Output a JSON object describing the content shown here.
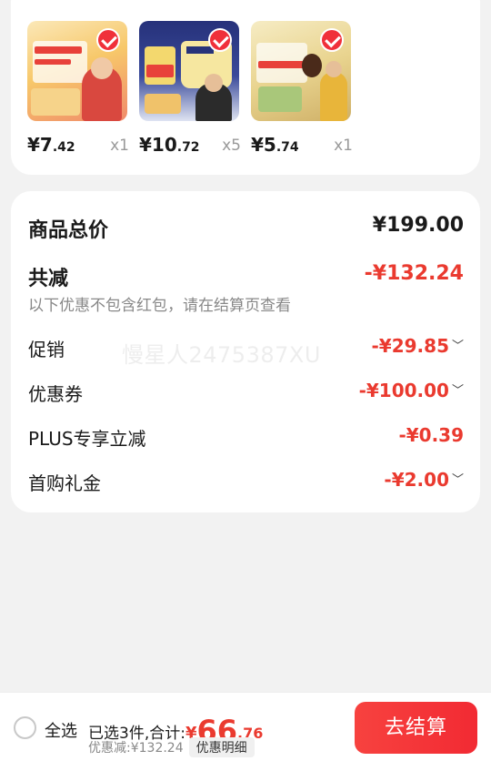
{
  "products": [
    {
      "price_int": "¥7",
      "price_dec": ".42",
      "qty": "x1",
      "selected": true,
      "thumb_colors": [
        "#fbe3a6",
        "#f5b24a"
      ]
    },
    {
      "price_int": "¥10",
      "price_dec": ".72",
      "qty": "x5",
      "selected": true,
      "thumb_colors": [
        "#27337a",
        "#f7d76a"
      ]
    },
    {
      "price_int": "¥5",
      "price_dec": ".74",
      "qty": "x1",
      "selected": true,
      "thumb_colors": [
        "#f4e7b8",
        "#c9a85a"
      ]
    }
  ],
  "summary": {
    "total_label": "商品总价",
    "total_value": "¥199.00",
    "reduce_label": "共减",
    "reduce_value": "-¥132.24",
    "note": "以下优惠不包含红包，请在结算页查看",
    "items": [
      {
        "label": "促销",
        "value": "-¥29.85",
        "expandable": true
      },
      {
        "label": "优惠券",
        "value": "-¥100.00",
        "expandable": true
      },
      {
        "label": "PLUS专享立减",
        "value": "-¥0.39",
        "expandable": false
      },
      {
        "label": "首购礼金",
        "value": "-¥2.00",
        "expandable": true
      }
    ]
  },
  "watermark": "慢星人2475387XU",
  "bottom": {
    "select_all": "全选",
    "selected_text": "已选3件,合计:",
    "total_sign": "¥",
    "total_int": "66",
    "total_dec": ".76",
    "discount_text": "优惠减:¥132.24",
    "detail_label": "优惠明细",
    "checkout_label": "去结算"
  },
  "colors": {
    "accent": "#ea3a2f",
    "checkout": "#f2353a"
  }
}
